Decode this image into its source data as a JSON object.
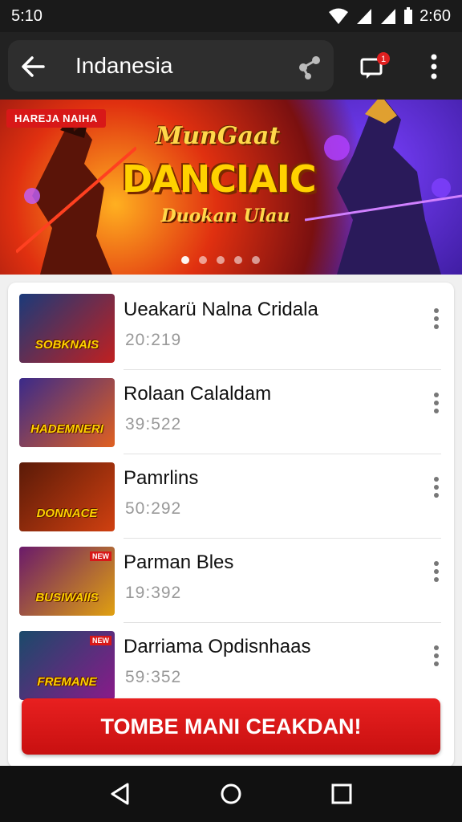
{
  "status": {
    "time": "5:10",
    "battery_time": "2:60"
  },
  "appbar": {
    "title": "Indanesia",
    "notification_badge": "1"
  },
  "banner": {
    "badge": "HAREJA NAIHA",
    "title_line1": "MunGaat",
    "title_line2": "DANCIAIC",
    "title_line3": "Duokan Ulau",
    "carousel": {
      "count": 5,
      "active_index": 0
    }
  },
  "items": [
    {
      "title": "Ueakarü Nalna Cridala",
      "subtitle": "20:219",
      "thumb_text": "SOBKNAIS",
      "thumb_tag": "",
      "colors": [
        "#1a3a7a",
        "#c02020"
      ]
    },
    {
      "title": "Rolaan Calaldam",
      "subtitle": "39:522",
      "thumb_text": "HADEMNERI",
      "thumb_tag": "",
      "colors": [
        "#3a2a8a",
        "#e06020"
      ]
    },
    {
      "title": "Pamrlins",
      "subtitle": "50:292",
      "thumb_text": "DONNACE",
      "thumb_tag": "",
      "colors": [
        "#5a1a08",
        "#d04010"
      ]
    },
    {
      "title": "Parman Bles",
      "subtitle": "19:392",
      "thumb_text": "BUSIWAIIS",
      "thumb_tag": "NEW",
      "colors": [
        "#6a1a6a",
        "#e0a010"
      ]
    },
    {
      "title": "Darriama Opdisnhaas",
      "subtitle": "59:352",
      "thumb_text": "FREMANE",
      "thumb_tag": "NEW",
      "colors": [
        "#1a4a6a",
        "#8a1a8a"
      ]
    }
  ],
  "cta": {
    "label": "TOMBE MANI CEAKDAN!"
  },
  "icons": {
    "back": "arrow-left-icon",
    "share": "share-icon",
    "cast": "cast-icon",
    "more": "more-vert-icon",
    "nav_back": "triangle-back-icon",
    "nav_home": "circle-home-icon",
    "nav_recent": "square-recent-icon"
  },
  "colors": {
    "accent": "#d81818",
    "appbar": "#222222",
    "background": "#f0f0f0"
  }
}
